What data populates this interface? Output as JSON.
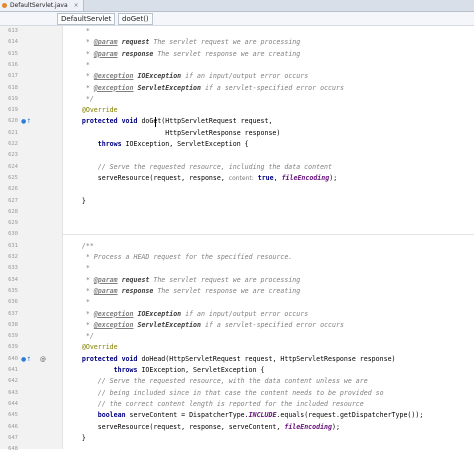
{
  "tabs": [
    {
      "label": "DefaultServlet.java",
      "close": "×"
    }
  ],
  "breadcrumbs": [
    "DefaultServlet",
    "doGet()"
  ],
  "lines": [
    {
      "n": "613",
      "parts": [
        [
          "c",
          "     *"
        ]
      ]
    },
    {
      "n": "614",
      "parts": [
        [
          "c",
          "     * "
        ],
        [
          "tag",
          "@param"
        ],
        [
          "pn",
          " request"
        ],
        [
          "c",
          " The servlet request we are processing"
        ]
      ]
    },
    {
      "n": "615",
      "parts": [
        [
          "c",
          "     * "
        ],
        [
          "tag",
          "@param"
        ],
        [
          "pn",
          " response"
        ],
        [
          "c",
          " The servlet response we are creating"
        ]
      ]
    },
    {
      "n": "616",
      "parts": [
        [
          "c",
          "     *"
        ]
      ]
    },
    {
      "n": "617",
      "parts": [
        [
          "c",
          "     * "
        ],
        [
          "tag",
          "@exception"
        ],
        [
          "pn",
          " IOException"
        ],
        [
          "c",
          " if an input/output error occurs"
        ]
      ]
    },
    {
      "n": "618",
      "parts": [
        [
          "c",
          "     * "
        ],
        [
          "tag",
          "@exception"
        ],
        [
          "pn",
          " ServletException"
        ],
        [
          "c",
          " if a servlet-specified error occurs"
        ]
      ]
    },
    {
      "n": "619",
      "parts": [
        [
          "c",
          "     */"
        ]
      ]
    },
    {
      "n": "619",
      "parts": [
        [
          "an",
          "    @Override"
        ]
      ]
    },
    {
      "n": "620",
      "parts": [
        [
          "kw",
          "    protected void "
        ],
        [
          "t",
          "doGet(HttpServletRequest request,"
        ]
      ]
    },
    {
      "n": "621",
      "parts": [
        [
          "t",
          "                         HttpServletResponse response)"
        ]
      ]
    },
    {
      "n": "622",
      "parts": [
        [
          "kw",
          "        throws "
        ],
        [
          "t",
          "IOException, ServletException {"
        ]
      ]
    },
    {
      "n": "623",
      "parts": [
        [
          "t",
          ""
        ]
      ]
    },
    {
      "n": "624",
      "parts": [
        [
          "c",
          "        // Serve the requested resource, including the data content"
        ]
      ]
    },
    {
      "n": "625",
      "parts": [
        [
          "t",
          "        serveResource(request, response, "
        ],
        [
          "hint",
          "content:"
        ],
        [
          "kw",
          " true"
        ],
        [
          "t",
          ", "
        ],
        [
          "st",
          "fileEncoding"
        ],
        [
          "t",
          ");"
        ]
      ]
    },
    {
      "n": "626",
      "parts": [
        [
          "t",
          ""
        ]
      ]
    },
    {
      "n": "627",
      "parts": [
        [
          "t",
          "    }"
        ]
      ]
    },
    {
      "n": "628",
      "parts": [
        [
          "t",
          ""
        ]
      ]
    },
    {
      "n": "629",
      "parts": [
        [
          "t",
          ""
        ]
      ]
    },
    {
      "n": "630",
      "parts": [
        [
          "t",
          ""
        ]
      ]
    },
    {
      "n": "631",
      "parts": [
        [
          "c",
          "    /**"
        ]
      ]
    },
    {
      "n": "632",
      "parts": [
        [
          "c",
          "     * Process a HEAD request for the specified resource."
        ]
      ]
    },
    {
      "n": "633",
      "parts": [
        [
          "c",
          "     *"
        ]
      ]
    },
    {
      "n": "634",
      "parts": [
        [
          "c",
          "     * "
        ],
        [
          "tag",
          "@param"
        ],
        [
          "pn",
          " request"
        ],
        [
          "c",
          " The servlet request we are processing"
        ]
      ]
    },
    {
      "n": "635",
      "parts": [
        [
          "c",
          "     * "
        ],
        [
          "tag",
          "@param"
        ],
        [
          "pn",
          " response"
        ],
        [
          "c",
          " The servlet response we are creating"
        ]
      ]
    },
    {
      "n": "636",
      "parts": [
        [
          "c",
          "     *"
        ]
      ]
    },
    {
      "n": "637",
      "parts": [
        [
          "c",
          "     * "
        ],
        [
          "tag",
          "@exception"
        ],
        [
          "pn",
          " IOException"
        ],
        [
          "c",
          " if an input/output error occurs"
        ]
      ]
    },
    {
      "n": "638",
      "parts": [
        [
          "c",
          "     * "
        ],
        [
          "tag",
          "@exception"
        ],
        [
          "pn",
          " ServletException"
        ],
        [
          "c",
          " if a servlet-specified error occurs"
        ]
      ]
    },
    {
      "n": "639",
      "parts": [
        [
          "c",
          "     */"
        ]
      ]
    },
    {
      "n": "639",
      "parts": [
        [
          "an",
          "    @Override"
        ]
      ]
    },
    {
      "n": "640",
      "parts": [
        [
          "kw",
          "    protected void "
        ],
        [
          "t",
          "doHead(HttpServletRequest request, HttpServletResponse response)"
        ]
      ]
    },
    {
      "n": "641",
      "parts": [
        [
          "kw",
          "            throws "
        ],
        [
          "t",
          "IOException, ServletException {"
        ]
      ]
    },
    {
      "n": "642",
      "parts": [
        [
          "c",
          "        // Serve the requested resource, with the data content unless we are"
        ]
      ]
    },
    {
      "n": "643",
      "parts": [
        [
          "c",
          "        // being included since in that case the content needs to be provided so"
        ]
      ]
    },
    {
      "n": "644",
      "parts": [
        [
          "c",
          "        // the correct content length is reported for the included resource"
        ]
      ]
    },
    {
      "n": "645",
      "parts": [
        [
          "kw",
          "        boolean "
        ],
        [
          "t",
          "serveContent = DispatcherType."
        ],
        [
          "st",
          "INCLUDE"
        ],
        [
          "t",
          ".equals(request.getDispatcherType());"
        ]
      ]
    },
    {
      "n": "646",
      "parts": [
        [
          "t",
          "        serveResource(request, response, serveContent, "
        ],
        [
          "st",
          "fileEncoding"
        ],
        [
          "t",
          ");"
        ]
      ]
    },
    {
      "n": "647",
      "parts": [
        [
          "t",
          "    }"
        ]
      ]
    },
    {
      "n": "648",
      "parts": [
        [
          "t",
          ""
        ]
      ]
    }
  ],
  "gutter_icons": [
    {
      "line": "620",
      "name": "override-method-icon",
      "glyph": "●↑"
    },
    {
      "line": "640",
      "name": "override-method-icon",
      "glyph": "●↑"
    },
    {
      "line": "640",
      "name": "annotation-at-icon",
      "glyph": "@"
    }
  ],
  "colors": {
    "keyword": "#000080",
    "comment": "#808080",
    "annotation": "#808000",
    "static": "#660e7a",
    "gutter_icon": "#2f7bd8"
  }
}
